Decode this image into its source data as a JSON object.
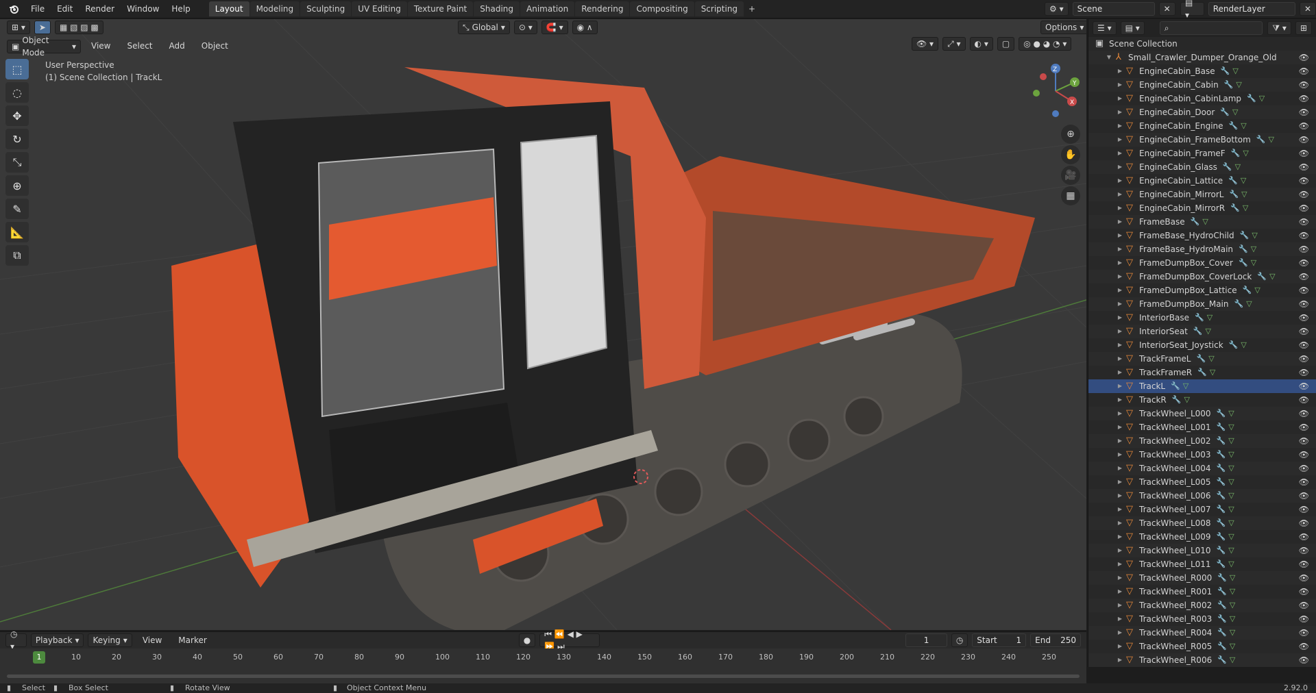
{
  "menu": [
    "File",
    "Edit",
    "Render",
    "Window",
    "Help"
  ],
  "workspaces": [
    {
      "label": "Layout",
      "active": true
    },
    {
      "label": "Modeling",
      "active": false
    },
    {
      "label": "Sculpting",
      "active": false
    },
    {
      "label": "UV Editing",
      "active": false
    },
    {
      "label": "Texture Paint",
      "active": false
    },
    {
      "label": "Shading",
      "active": false
    },
    {
      "label": "Animation",
      "active": false
    },
    {
      "label": "Rendering",
      "active": false
    },
    {
      "label": "Compositing",
      "active": false
    },
    {
      "label": "Scripting",
      "active": false
    }
  ],
  "scene": "Scene",
  "render_layer": "RenderLayer",
  "viewport": {
    "mode": "Object Mode",
    "menus": [
      "View",
      "Select",
      "Add",
      "Object"
    ],
    "transform": "Global",
    "options": "Options",
    "perspective": "User Perspective",
    "collection_info": "(1) Scene Collection | TrackL"
  },
  "outliner": {
    "root": "Scene Collection",
    "collection": "Small_Crawler_Dumper_Orange_Old",
    "objects": [
      "EngineCabin_Base",
      "EngineCabin_Cabin",
      "EngineCabin_CabinLamp",
      "EngineCabin_Door",
      "EngineCabin_Engine",
      "EngineCabin_FrameBottom",
      "EngineCabin_FrameF",
      "EngineCabin_Glass",
      "EngineCabin_Lattice",
      "EngineCabin_MirrorL",
      "EngineCabin_MirrorR",
      "FrameBase",
      "FrameBase_HydroChild",
      "FrameBase_HydroMain",
      "FrameDumpBox_Cover",
      "FrameDumpBox_CoverLock",
      "FrameDumpBox_Lattice",
      "FrameDumpBox_Main",
      "InteriorBase",
      "InteriorSeat",
      "InteriorSeat_Joystick",
      "TrackFrameL",
      "TrackFrameR",
      "TrackL",
      "TrackR",
      "TrackWheel_L000",
      "TrackWheel_L001",
      "TrackWheel_L002",
      "TrackWheel_L003",
      "TrackWheel_L004",
      "TrackWheel_L005",
      "TrackWheel_L006",
      "TrackWheel_L007",
      "TrackWheel_L008",
      "TrackWheel_L009",
      "TrackWheel_L010",
      "TrackWheel_L011",
      "TrackWheel_R000",
      "TrackWheel_R001",
      "TrackWheel_R002",
      "TrackWheel_R003",
      "TrackWheel_R004",
      "TrackWheel_R005",
      "TrackWheel_R006"
    ],
    "selected": "TrackL"
  },
  "timeline": {
    "menus": [
      "Playback",
      "Keying",
      "View",
      "Marker"
    ],
    "current_frame": "1",
    "start_label": "Start",
    "start": "1",
    "end_label": "End",
    "end": "250",
    "ticks": [
      "10",
      "20",
      "30",
      "40",
      "50",
      "60",
      "70",
      "80",
      "90",
      "100",
      "110",
      "120",
      "130",
      "140",
      "150",
      "160",
      "170",
      "180",
      "190",
      "200",
      "210",
      "220",
      "230",
      "240",
      "250"
    ]
  },
  "status": {
    "select": "Select",
    "box_select": "Box Select",
    "rotate_view": "Rotate View",
    "context_menu": "Object Context Menu",
    "version": "2.92.0"
  },
  "colors": {
    "accent": "#4a6d96",
    "selection": "#334d80",
    "object_orange": "#e8893a",
    "dumper_orange": "#d9532a"
  }
}
